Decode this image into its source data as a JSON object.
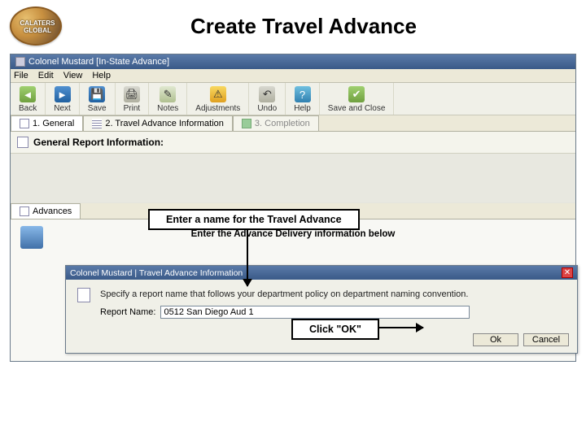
{
  "slide": {
    "title": "Create Travel Advance",
    "logo_text": "CALATERS GLOBAL"
  },
  "window": {
    "title": "Colonel Mustard [In-State Advance]",
    "menu": {
      "file": "File",
      "edit": "Edit",
      "view": "View",
      "help": "Help"
    },
    "toolbar": {
      "back": "Back",
      "next": "Next",
      "save": "Save",
      "print": "Print",
      "notes": "Notes",
      "adjustments": "Adjustments",
      "undo": "Undo",
      "help": "Help",
      "save_close": "Save and Close"
    },
    "tabs": {
      "t1": "1. General",
      "t2": "2. Travel Advance Information",
      "t3": "3. Completion"
    },
    "section": "General Report Information:",
    "sub_tab": "Advances",
    "delivery_msg": "Enter the Advance Delivery information below"
  },
  "dialog": {
    "title": "Colonel Mustard | Travel Advance Information",
    "instruction": "Specify a report name that follows your department policy on department naming convention.",
    "field_label": "Report Name:",
    "field_value": "0512 San Diego Aud 1",
    "ok": "Ok",
    "cancel": "Cancel"
  },
  "callouts": {
    "name_prompt": "Enter a name for the Travel Advance",
    "ok_prompt": "Click  \"OK\""
  }
}
